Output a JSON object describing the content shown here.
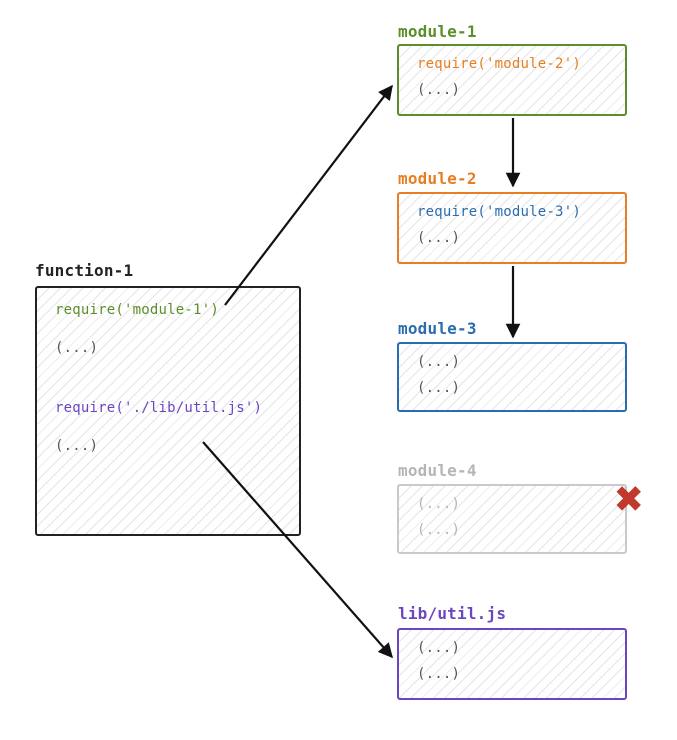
{
  "function1": {
    "label": "function-1",
    "require_mod1": "require('module-1')",
    "ellipsis1": "(...)",
    "require_util": "require('./lib/util.js')",
    "ellipsis2": "(...)"
  },
  "module1": {
    "label": "module-1",
    "require_mod2": "require('module-2')",
    "ellipsis": "(...)"
  },
  "module2": {
    "label": "module-2",
    "require_mod3": "require('module-3')",
    "ellipsis": "(...)"
  },
  "module3": {
    "label": "module-3",
    "ellipsis1": "(...)",
    "ellipsis2": "(...)"
  },
  "module4": {
    "label": "module-4",
    "ellipsis1": "(...)",
    "ellipsis2": "(...)"
  },
  "util": {
    "label": "lib/util.js",
    "ellipsis1": "(...)",
    "ellipsis2": "(...)"
  },
  "colors": {
    "black": "#222222",
    "green": "#5a8f2a",
    "orange": "#e67e22",
    "blue": "#2b6cb0",
    "purple": "#6b46c1",
    "gray": "#b5b5b5",
    "red": "#c0392b"
  }
}
